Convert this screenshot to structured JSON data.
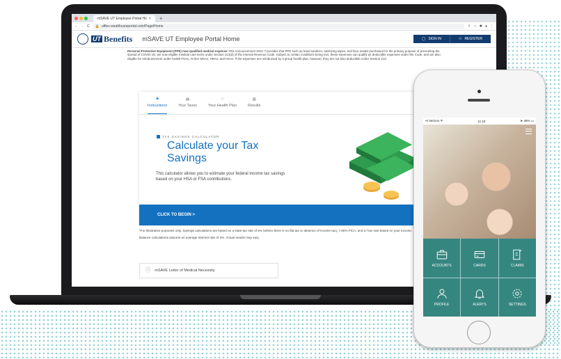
{
  "browser": {
    "tab_title": "mSAVE UT Employee Portal Ho",
    "url": "utflex.wealthcareportal.com/Page/Home"
  },
  "site": {
    "logo_mark": "UT",
    "logo_text": "Benefits",
    "portal_title": "mSAVE UT Employee Portal Home",
    "sign_in": "SIGN IN",
    "register": "REGISTER"
  },
  "notice": {
    "bold": "Personal Protective Equipment (PPE) now qualified medical expense:",
    "text": " IRS Announcement 2021-7 provides that PPE such as hand sanitizer, sanitizing wipes, and face masks purchased for the primary purpose of preventing the spread of COVID-19, are now eligible medical care items under Section 213(d) of the Internal Revenue Code. Subject to certain conditions being met, these expenses can qualify as deductible expenses under the Code, and are also eligible for reimbursement under health FSAs, Archer MSAs, HRAs, and HSAs. If the expenses are reimbursed by a group health plan, however, they are not also deductible under Section 213."
  },
  "calculator": {
    "tabs": [
      "Instructions",
      "Your Taxes",
      "Your Health Plan",
      "Results"
    ],
    "eyebrow": "TAX SAVINGS CALCULATOR",
    "title": "Calculate your Tax Savings",
    "description": "This calculator allows you to estimate your federal income tax savings based on your HSA or FSA contributions.",
    "cta": "CLICK TO BEGIN  >"
  },
  "footnotes": {
    "line1": "*For illustrative purposes only. Savings calculations are based on a state tax rate of 5% (where there is no flat tax or absence of income tax), 7.65% FICA, and a f tax rate based on your income.",
    "line2": "Balance calculations assume an average interest rate of 3%. Actual results may vary."
  },
  "letter": {
    "label": "mSAVE Letter of Medical Necessity"
  },
  "phone": {
    "carrier": "Verizon",
    "time": "11:18",
    "battery": "46%",
    "tiles": [
      "ACCOUNTS",
      "CARDS",
      "CLAIMS",
      "PROFILE",
      "ALERTS",
      "SETTINGS"
    ]
  },
  "colors": {
    "brand_navy": "#123b6e",
    "accent_blue": "#1371c0",
    "tile_teal": "#2c7f7a"
  }
}
